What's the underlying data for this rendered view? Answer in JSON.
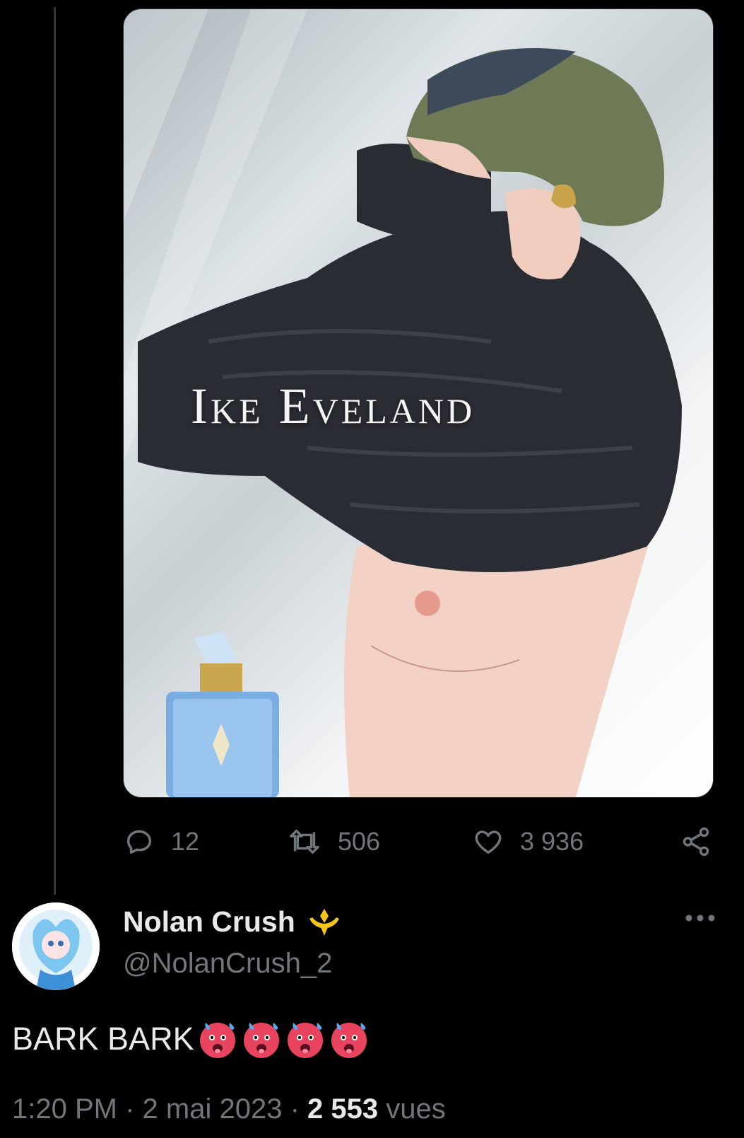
{
  "media": {
    "title": "Ike Eveland"
  },
  "actions": {
    "replies": "12",
    "retweets": "506",
    "likes": "3 936"
  },
  "reply_author": {
    "name": "Nolan Crush",
    "handle": "@NolanCrush_2",
    "badge_icon": "affiliate-badge-icon"
  },
  "tweet": {
    "text": "BARK BARK",
    "emojis": [
      "hot-face-emoji",
      "hot-face-emoji",
      "hot-face-emoji",
      "hot-face-emoji"
    ],
    "time": "1:20 PM",
    "date": "2 mai 2023",
    "views_count": "2 553",
    "views_label": "vues",
    "separator": "·"
  },
  "colors": {
    "background": "#000000",
    "text": "#e7e9ea",
    "muted": "#71767b",
    "badge": "#f5c518"
  }
}
